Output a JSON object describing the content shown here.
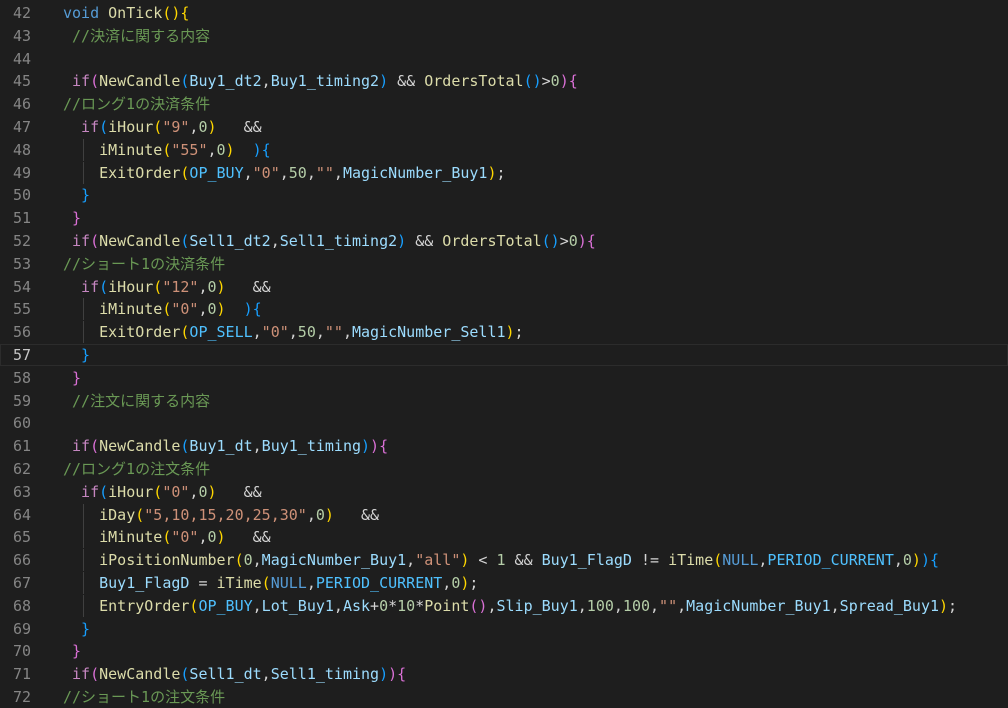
{
  "editor": {
    "language": "MQL4",
    "active_line": 57,
    "lines": [
      {
        "n": "42",
        "indent": 0,
        "guides": [],
        "tokens": [
          [
            "void",
            "kw"
          ],
          [
            " ",
            "op"
          ],
          [
            "OnTick",
            "fn"
          ],
          [
            "()",
            "p1"
          ],
          [
            "{",
            "p1"
          ]
        ]
      },
      {
        "n": "43",
        "indent": 1,
        "guides": [],
        "tokens": [
          [
            "//決済に関する内容",
            "cmt"
          ]
        ]
      },
      {
        "n": "44",
        "indent": 0,
        "guides": [],
        "tokens": []
      },
      {
        "n": "45",
        "indent": 1,
        "guides": [],
        "tokens": [
          [
            "if",
            "ctl"
          ],
          [
            "(",
            "p2"
          ],
          [
            "NewCandle",
            "fn"
          ],
          [
            "(",
            "p3"
          ],
          [
            "Buy1_dt2",
            "var"
          ],
          [
            ",",
            "op"
          ],
          [
            "Buy1_timing2",
            "var"
          ],
          [
            ")",
            "p3"
          ],
          [
            " && ",
            "op"
          ],
          [
            "OrdersTotal",
            "fn"
          ],
          [
            "()",
            "p3"
          ],
          [
            ">",
            "op"
          ],
          [
            "0",
            "num"
          ],
          [
            ")",
            "p2"
          ],
          [
            "{",
            "p2"
          ]
        ]
      },
      {
        "n": "46",
        "indent": 0,
        "guides": [],
        "tokens": [
          [
            "//ロング1の決済条件",
            "cmt"
          ]
        ]
      },
      {
        "n": "47",
        "indent": 2,
        "guides": [],
        "tokens": [
          [
            "if",
            "ctl"
          ],
          [
            "(",
            "p3"
          ],
          [
            "iHour",
            "fn"
          ],
          [
            "(",
            "p1"
          ],
          [
            "\"9\"",
            "str"
          ],
          [
            ",",
            "op"
          ],
          [
            "0",
            "num"
          ],
          [
            ")",
            "p1"
          ],
          [
            "   &&",
            "op"
          ]
        ]
      },
      {
        "n": "48",
        "indent": 4,
        "guides": [
          2
        ],
        "tokens": [
          [
            "iMinute",
            "fn"
          ],
          [
            "(",
            "p1"
          ],
          [
            "\"55\"",
            "str"
          ],
          [
            ",",
            "op"
          ],
          [
            "0",
            "num"
          ],
          [
            ")",
            "p1"
          ],
          [
            "  ",
            "op"
          ],
          [
            ")",
            "p3"
          ],
          [
            "{",
            "p3"
          ]
        ]
      },
      {
        "n": "49",
        "indent": 4,
        "guides": [
          2
        ],
        "tokens": [
          [
            "ExitOrder",
            "fn"
          ],
          [
            "(",
            "p1"
          ],
          [
            "OP_BUY",
            "const"
          ],
          [
            ",",
            "op"
          ],
          [
            "\"0\"",
            "str"
          ],
          [
            ",",
            "op"
          ],
          [
            "50",
            "num"
          ],
          [
            ",",
            "op"
          ],
          [
            "\"\"",
            "str"
          ],
          [
            ",",
            "op"
          ],
          [
            "MagicNumber_Buy1",
            "var"
          ],
          [
            ")",
            "p1"
          ],
          [
            ";",
            "op"
          ]
        ]
      },
      {
        "n": "50",
        "indent": 2,
        "guides": [],
        "tokens": [
          [
            "}",
            "p3"
          ]
        ]
      },
      {
        "n": "51",
        "indent": 1,
        "guides": [],
        "tokens": [
          [
            "}",
            "p2"
          ]
        ]
      },
      {
        "n": "52",
        "indent": 1,
        "guides": [],
        "tokens": [
          [
            "if",
            "ctl"
          ],
          [
            "(",
            "p2"
          ],
          [
            "NewCandle",
            "fn"
          ],
          [
            "(",
            "p3"
          ],
          [
            "Sell1_dt2",
            "var"
          ],
          [
            ",",
            "op"
          ],
          [
            "Sell1_timing2",
            "var"
          ],
          [
            ")",
            "p3"
          ],
          [
            " && ",
            "op"
          ],
          [
            "OrdersTotal",
            "fn"
          ],
          [
            "()",
            "p3"
          ],
          [
            ">",
            "op"
          ],
          [
            "0",
            "num"
          ],
          [
            ")",
            "p2"
          ],
          [
            "{",
            "p2"
          ]
        ]
      },
      {
        "n": "53",
        "indent": 0,
        "guides": [],
        "tokens": [
          [
            "//ショート1の決済条件",
            "cmt"
          ]
        ]
      },
      {
        "n": "54",
        "indent": 2,
        "guides": [],
        "tokens": [
          [
            "if",
            "ctl"
          ],
          [
            "(",
            "p3"
          ],
          [
            "iHour",
            "fn"
          ],
          [
            "(",
            "p1"
          ],
          [
            "\"12\"",
            "str"
          ],
          [
            ",",
            "op"
          ],
          [
            "0",
            "num"
          ],
          [
            ")",
            "p1"
          ],
          [
            "   &&",
            "op"
          ]
        ]
      },
      {
        "n": "55",
        "indent": 4,
        "guides": [
          2
        ],
        "tokens": [
          [
            "iMinute",
            "fn"
          ],
          [
            "(",
            "p1"
          ],
          [
            "\"0\"",
            "str"
          ],
          [
            ",",
            "op"
          ],
          [
            "0",
            "num"
          ],
          [
            ")",
            "p1"
          ],
          [
            "  ",
            "op"
          ],
          [
            ")",
            "p3"
          ],
          [
            "{",
            "p3"
          ]
        ]
      },
      {
        "n": "56",
        "indent": 4,
        "guides": [
          2
        ],
        "tokens": [
          [
            "ExitOrder",
            "fn"
          ],
          [
            "(",
            "p1"
          ],
          [
            "OP_SELL",
            "const"
          ],
          [
            ",",
            "op"
          ],
          [
            "\"0\"",
            "str"
          ],
          [
            ",",
            "op"
          ],
          [
            "50",
            "num"
          ],
          [
            ",",
            "op"
          ],
          [
            "\"\"",
            "str"
          ],
          [
            ",",
            "op"
          ],
          [
            "MagicNumber_Sell1",
            "var"
          ],
          [
            ")",
            "p1"
          ],
          [
            ";",
            "op"
          ]
        ]
      },
      {
        "n": "57",
        "indent": 2,
        "guides": [],
        "tokens": [
          [
            "}",
            "p3"
          ]
        ]
      },
      {
        "n": "58",
        "indent": 1,
        "guides": [],
        "tokens": [
          [
            "}",
            "p2"
          ]
        ]
      },
      {
        "n": "59",
        "indent": 1,
        "guides": [],
        "tokens": [
          [
            "//注文に関する内容",
            "cmt"
          ]
        ]
      },
      {
        "n": "60",
        "indent": 0,
        "guides": [],
        "tokens": []
      },
      {
        "n": "61",
        "indent": 1,
        "guides": [],
        "tokens": [
          [
            "if",
            "ctl"
          ],
          [
            "(",
            "p2"
          ],
          [
            "NewCandle",
            "fn"
          ],
          [
            "(",
            "p3"
          ],
          [
            "Buy1_dt",
            "var"
          ],
          [
            ",",
            "op"
          ],
          [
            "Buy1_timing",
            "var"
          ],
          [
            ")",
            "p3"
          ],
          [
            ")",
            "p2"
          ],
          [
            "{",
            "p2"
          ]
        ]
      },
      {
        "n": "62",
        "indent": 0,
        "guides": [],
        "tokens": [
          [
            "//ロング1の注文条件",
            "cmt"
          ]
        ]
      },
      {
        "n": "63",
        "indent": 2,
        "guides": [],
        "tokens": [
          [
            "if",
            "ctl"
          ],
          [
            "(",
            "p3"
          ],
          [
            "iHour",
            "fn"
          ],
          [
            "(",
            "p1"
          ],
          [
            "\"0\"",
            "str"
          ],
          [
            ",",
            "op"
          ],
          [
            "0",
            "num"
          ],
          [
            ")",
            "p1"
          ],
          [
            "   &&",
            "op"
          ]
        ]
      },
      {
        "n": "64",
        "indent": 4,
        "guides": [
          2
        ],
        "tokens": [
          [
            "iDay",
            "fn"
          ],
          [
            "(",
            "p1"
          ],
          [
            "\"5,10,15,20,25,30\"",
            "str"
          ],
          [
            ",",
            "op"
          ],
          [
            "0",
            "num"
          ],
          [
            ")",
            "p1"
          ],
          [
            "   &&",
            "op"
          ]
        ]
      },
      {
        "n": "65",
        "indent": 4,
        "guides": [
          2
        ],
        "tokens": [
          [
            "iMinute",
            "fn"
          ],
          [
            "(",
            "p1"
          ],
          [
            "\"0\"",
            "str"
          ],
          [
            ",",
            "op"
          ],
          [
            "0",
            "num"
          ],
          [
            ")",
            "p1"
          ],
          [
            "   &&",
            "op"
          ]
        ]
      },
      {
        "n": "66",
        "indent": 4,
        "guides": [
          2
        ],
        "tokens": [
          [
            "iPositionNumber",
            "fn"
          ],
          [
            "(",
            "p1"
          ],
          [
            "0",
            "num"
          ],
          [
            ",",
            "op"
          ],
          [
            "MagicNumber_Buy1",
            "var"
          ],
          [
            ",",
            "op"
          ],
          [
            "\"all\"",
            "str"
          ],
          [
            ")",
            "p1"
          ],
          [
            " < ",
            "op"
          ],
          [
            "1",
            "num"
          ],
          [
            " && ",
            "op"
          ],
          [
            "Buy1_FlagD",
            "var"
          ],
          [
            " != ",
            "op"
          ],
          [
            "iTime",
            "fn"
          ],
          [
            "(",
            "p1"
          ],
          [
            "NULL",
            "kw"
          ],
          [
            ",",
            "op"
          ],
          [
            "PERIOD_CURRENT",
            "const"
          ],
          [
            ",",
            "op"
          ],
          [
            "0",
            "num"
          ],
          [
            ")",
            "p1"
          ],
          [
            ")",
            "p3"
          ],
          [
            "{",
            "p3"
          ]
        ]
      },
      {
        "n": "67",
        "indent": 4,
        "guides": [
          2
        ],
        "tokens": [
          [
            "Buy1_FlagD",
            "var"
          ],
          [
            " = ",
            "op"
          ],
          [
            "iTime",
            "fn"
          ],
          [
            "(",
            "p1"
          ],
          [
            "NULL",
            "kw"
          ],
          [
            ",",
            "op"
          ],
          [
            "PERIOD_CURRENT",
            "const"
          ],
          [
            ",",
            "op"
          ],
          [
            "0",
            "num"
          ],
          [
            ")",
            "p1"
          ],
          [
            ";",
            "op"
          ]
        ]
      },
      {
        "n": "68",
        "indent": 4,
        "guides": [
          2
        ],
        "tokens": [
          [
            "EntryOrder",
            "fn"
          ],
          [
            "(",
            "p1"
          ],
          [
            "OP_BUY",
            "const"
          ],
          [
            ",",
            "op"
          ],
          [
            "Lot_Buy1",
            "var"
          ],
          [
            ",",
            "op"
          ],
          [
            "Ask",
            "var"
          ],
          [
            "+",
            "op"
          ],
          [
            "0",
            "num"
          ],
          [
            "*",
            "op"
          ],
          [
            "10",
            "num"
          ],
          [
            "*",
            "op"
          ],
          [
            "Point",
            "fn"
          ],
          [
            "()",
            "p2"
          ],
          [
            ",",
            "op"
          ],
          [
            "Slip_Buy1",
            "var"
          ],
          [
            ",",
            "op"
          ],
          [
            "100",
            "num"
          ],
          [
            ",",
            "op"
          ],
          [
            "100",
            "num"
          ],
          [
            ",",
            "op"
          ],
          [
            "\"\"",
            "str"
          ],
          [
            ",",
            "op"
          ],
          [
            "MagicNumber_Buy1",
            "var"
          ],
          [
            ",",
            "op"
          ],
          [
            "Spread_Buy1",
            "var"
          ],
          [
            ")",
            "p1"
          ],
          [
            ";",
            "op"
          ]
        ]
      },
      {
        "n": "69",
        "indent": 2,
        "guides": [],
        "tokens": [
          [
            "}",
            "p3"
          ]
        ]
      },
      {
        "n": "70",
        "indent": 1,
        "guides": [],
        "tokens": [
          [
            "}",
            "p2"
          ]
        ]
      },
      {
        "n": "71",
        "indent": 1,
        "guides": [],
        "tokens": [
          [
            "if",
            "ctl"
          ],
          [
            "(",
            "p2"
          ],
          [
            "NewCandle",
            "fn"
          ],
          [
            "(",
            "p3"
          ],
          [
            "Sell1_dt",
            "var"
          ],
          [
            ",",
            "op"
          ],
          [
            "Sell1_timing",
            "var"
          ],
          [
            ")",
            "p3"
          ],
          [
            ")",
            "p2"
          ],
          [
            "{",
            "p2"
          ]
        ]
      },
      {
        "n": "72",
        "indent": 0,
        "guides": [],
        "tokens": [
          [
            "//ショート1の注文条件",
            "cmt"
          ]
        ]
      }
    ]
  }
}
